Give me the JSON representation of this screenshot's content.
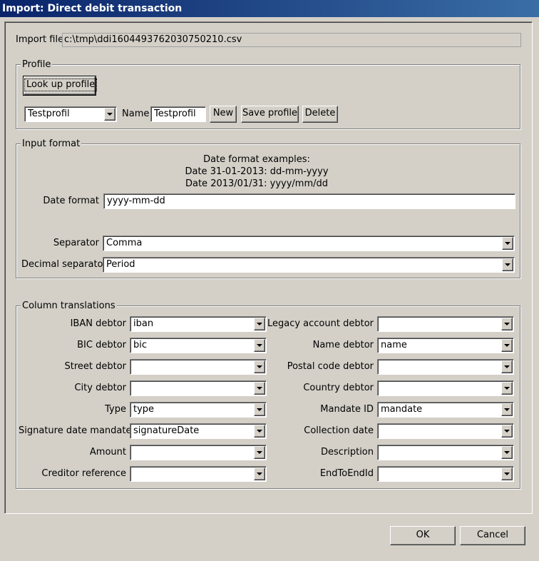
{
  "window": {
    "title": "Import: Direct debit transaction"
  },
  "import_file": {
    "label": "Import file",
    "value": "c:\\tmp\\ddi1604493762030750210.csv"
  },
  "profile": {
    "legend": "Profile",
    "lookup_button": "Look up profile",
    "selected": "Testprofil",
    "name_label": "Name",
    "name_value": "Testprofil",
    "new_button": "New",
    "save_button": "Save profile",
    "delete_button": "Delete"
  },
  "input_format": {
    "legend": "Input format",
    "examples_title": "Date format examples:",
    "example1": "Date 31-01-2013: dd-mm-yyyy",
    "example2": "Date 2013/01/31: yyyy/mm/dd",
    "date_format_label": "Date format",
    "date_format_value": "yyyy-mm-dd",
    "separator_label": "Separator",
    "separator_value": "Comma",
    "decimal_label": "Decimal separator",
    "decimal_value": "Period"
  },
  "columns": {
    "legend": "Column translations",
    "left": [
      {
        "label": "IBAN debtor",
        "value": "iban"
      },
      {
        "label": "BIC debtor",
        "value": "bic"
      },
      {
        "label": "Street debtor",
        "value": ""
      },
      {
        "label": "City debtor",
        "value": ""
      },
      {
        "label": "Type",
        "value": "type"
      },
      {
        "label": "Signature date mandate",
        "value": "signatureDate"
      },
      {
        "label": "Amount",
        "value": ""
      },
      {
        "label": "Creditor reference",
        "value": ""
      }
    ],
    "right": [
      {
        "label": "Legacy account debtor",
        "value": ""
      },
      {
        "label": "Name debtor",
        "value": "name"
      },
      {
        "label": "Postal code debtor",
        "value": ""
      },
      {
        "label": "Country debtor",
        "value": ""
      },
      {
        "label": "Mandate ID",
        "value": "mandate"
      },
      {
        "label": "Collection date",
        "value": ""
      },
      {
        "label": "Description",
        "value": ""
      },
      {
        "label": "EndToEndId",
        "value": ""
      }
    ]
  },
  "footer": {
    "ok": "OK",
    "cancel": "Cancel"
  }
}
